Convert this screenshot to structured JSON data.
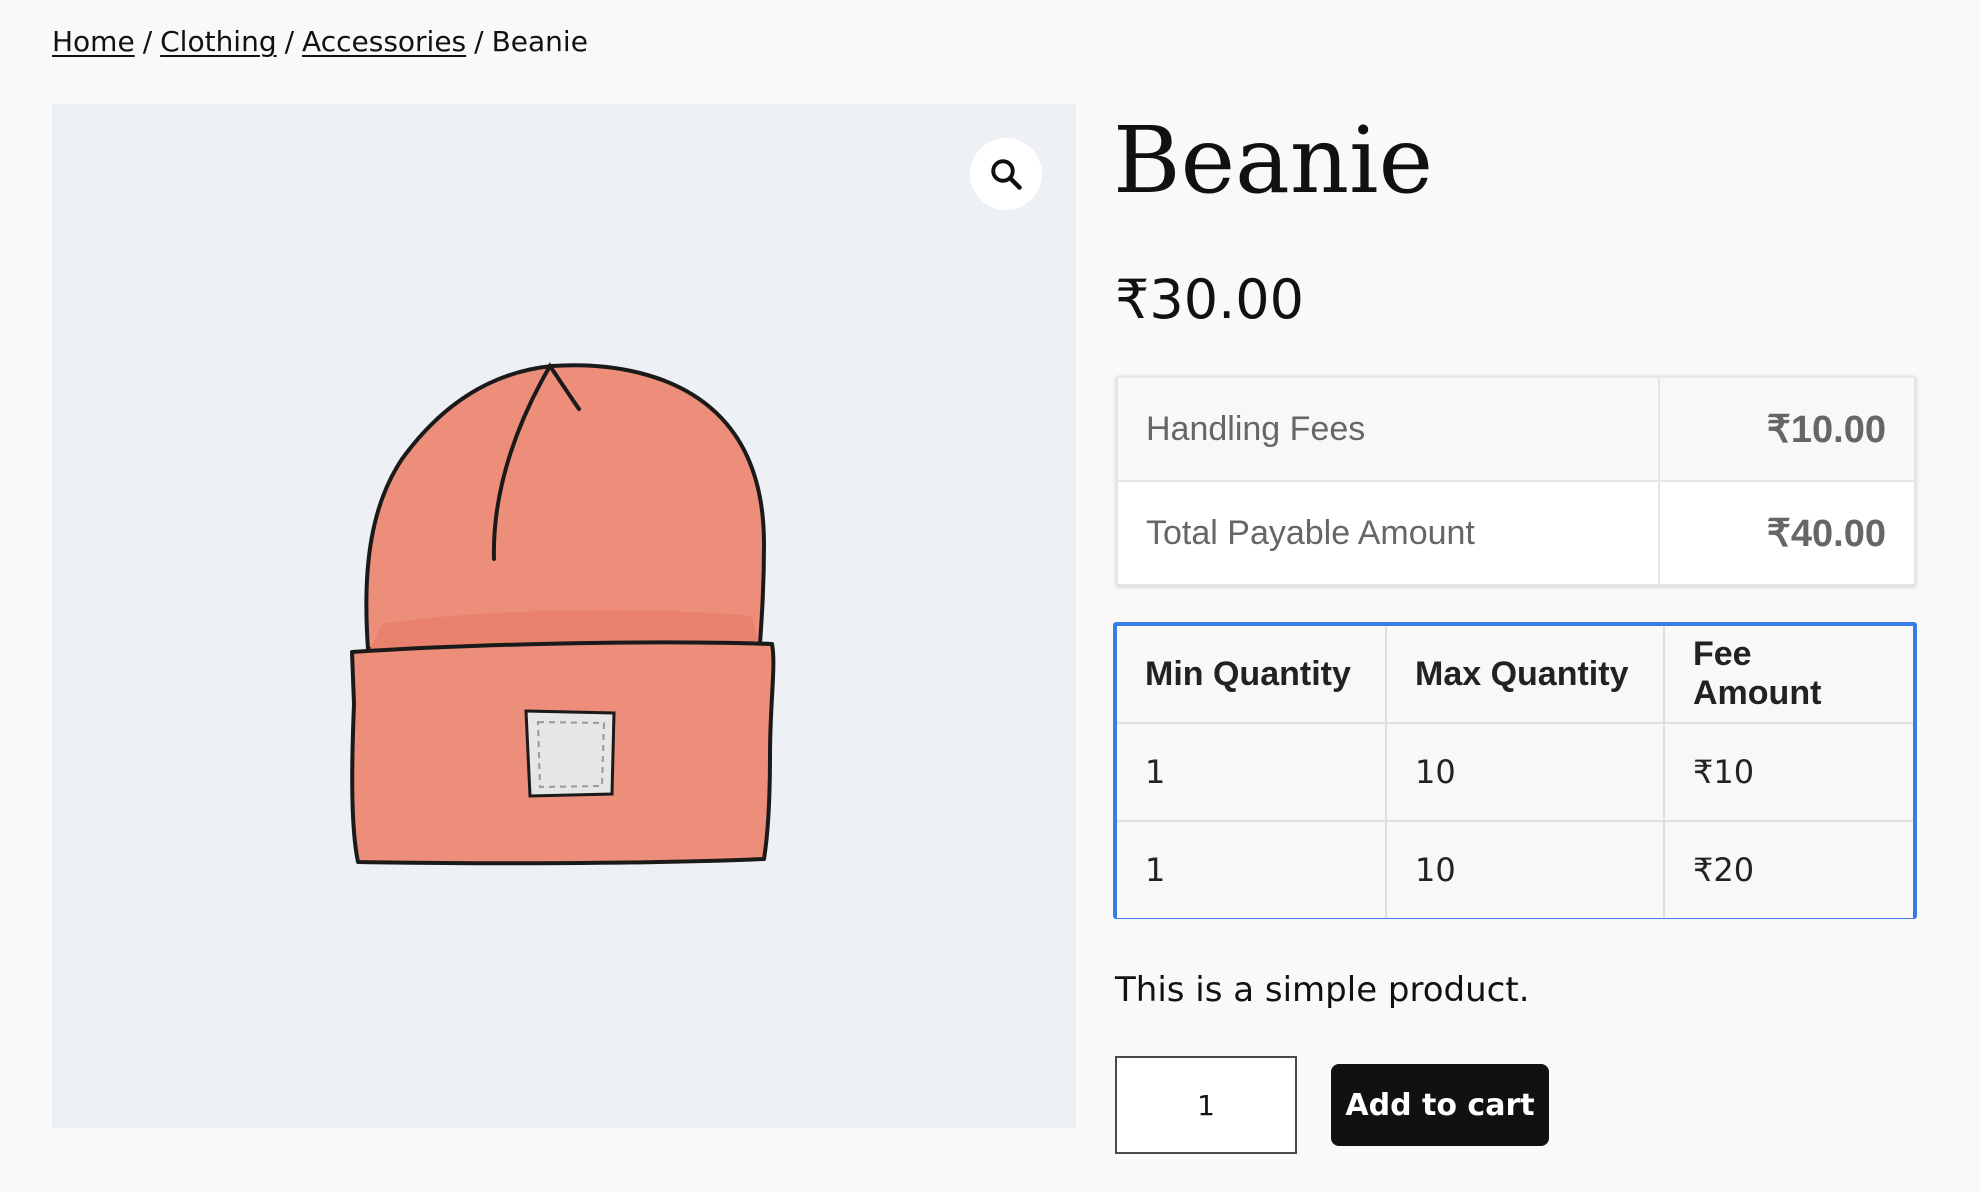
{
  "breadcrumb": {
    "items": [
      {
        "label": "Home"
      },
      {
        "label": "Clothing"
      },
      {
        "label": "Accessories"
      }
    ],
    "separator": "/",
    "current": "Beanie"
  },
  "gallery": {
    "zoom_icon": "magnifier-icon",
    "image_subject": "beanie"
  },
  "product": {
    "title": "Beanie",
    "price": "₹30.00",
    "description": "This is a simple product."
  },
  "fees": {
    "rows": [
      {
        "label": "Handling Fees",
        "amount": "₹10.00"
      },
      {
        "label": "Total Payable Amount",
        "amount": "₹40.00"
      }
    ]
  },
  "tiers": {
    "headers": [
      "Min Quantity",
      "Max Quantity",
      "Fee Amount"
    ],
    "rows": [
      [
        "1",
        "10",
        "₹10"
      ],
      [
        "1",
        "10",
        "₹20"
      ]
    ],
    "highlight_color": "#3a7be6"
  },
  "cart": {
    "quantity": "1",
    "add_label": "Add to cart"
  }
}
